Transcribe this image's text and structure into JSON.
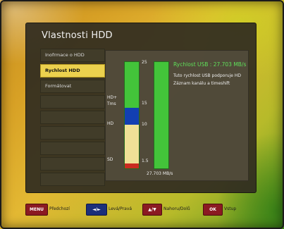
{
  "dialog": {
    "title": "Vlastnosti HDD"
  },
  "menu": {
    "items": [
      {
        "label": "Inofrmace o HDD",
        "selected": false
      },
      {
        "label": "Rychlost HDD",
        "selected": true
      },
      {
        "label": "Formátovat",
        "selected": false
      }
    ]
  },
  "panel": {
    "scale_labels": [
      "25",
      "15",
      "10",
      "1.5"
    ],
    "gauge_labels": {
      "hd_tms": "HD+\nTms",
      "hd": "HD",
      "sd": "SD"
    },
    "usb_speed_title": "Rychlost USB : 27.703 MB/s",
    "usb_speed_value": "27.703 MB/s",
    "usb_speed_mbps": 27.703,
    "description_line1": "Tuto rychlost USB podporuje HD",
    "description_line2": "Záznam kanálu a timeshift",
    "colors": {
      "green": "#43c43a",
      "blue": "#123fb2",
      "yellow": "#efe096",
      "red": "#c92b20",
      "title_green": "#5fe05a"
    }
  },
  "hints": [
    {
      "key": "MENU",
      "text": "Předchozí",
      "key_color": "#8b1a22"
    },
    {
      "key": "◄/►",
      "text": "Levá/Pravá",
      "key_color": "#1b2f7a"
    },
    {
      "key": "▲/▼",
      "text": "Nahoru/Dolů",
      "key_color": "#8b1a22"
    },
    {
      "key": "OK",
      "text": "Vstup",
      "key_color": "#8b1a22"
    }
  ]
}
